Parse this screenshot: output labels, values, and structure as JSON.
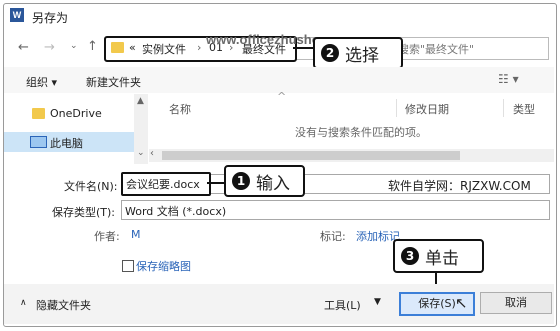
{
  "window": {
    "title": "另存为",
    "icon": "word-icon"
  },
  "address": {
    "prefix": "«",
    "crumbs": [
      "实例文件",
      "01",
      "最终文件"
    ],
    "separator": "›",
    "search_placeholder": "搜索\"最终文件\""
  },
  "watermark": "www.officezhushou.com",
  "toolbar": {
    "organize": "组织 ▾",
    "new_folder": "新建文件夹",
    "view_icon": "view-options-icon"
  },
  "nav_pane": {
    "items": [
      {
        "label": "OneDrive",
        "icon": "folder-icon"
      },
      {
        "label": "此电脑",
        "icon": "computer-icon"
      }
    ]
  },
  "file_list": {
    "columns": {
      "name": "名称",
      "modified": "修改日期",
      "type": "类型"
    },
    "empty_message": "没有与搜索条件匹配的项。"
  },
  "form": {
    "filename_label": "文件名(N):",
    "filename_value": "会议纪要.docx",
    "savetype_label": "保存类型(T):",
    "savetype_value": "Word 文档 (*.docx)",
    "authors_label": "作者:",
    "authors_value": "M",
    "tags_label": "标记:",
    "tags_value": "添加标记",
    "thumbnail_label": "保存缩略图"
  },
  "footer": {
    "hide_folders": "隐藏文件夹",
    "tools": "工具(L)",
    "save": "保存(S)",
    "cancel": "取消"
  },
  "annotations": {
    "step1": {
      "num": "1",
      "text": "输入"
    },
    "step2": {
      "num": "2",
      "text": "选择"
    },
    "step3": {
      "num": "3",
      "text": "单击"
    },
    "site": "软件自学网：RJZXW.COM"
  }
}
